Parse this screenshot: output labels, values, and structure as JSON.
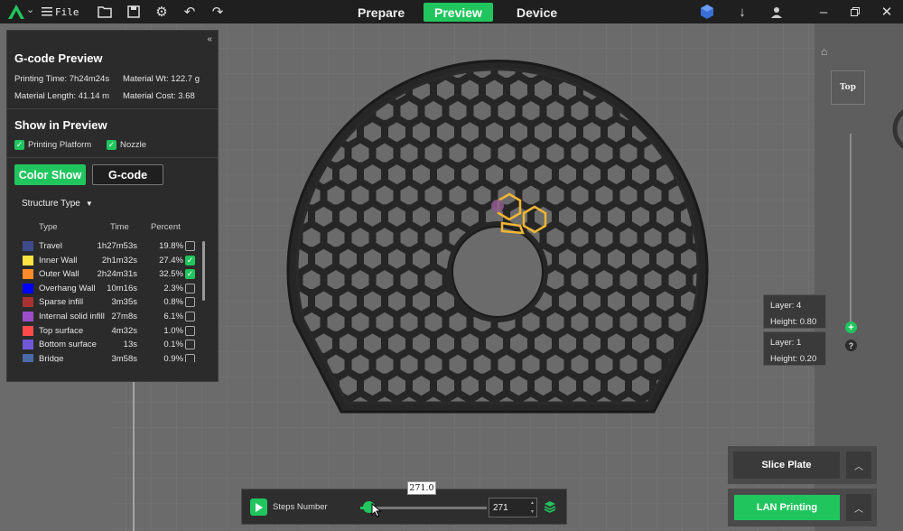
{
  "topbar": {
    "file_label": "File",
    "tabs": [
      {
        "label": "Prepare",
        "active": false
      },
      {
        "label": "Preview",
        "active": true
      },
      {
        "label": "Device",
        "active": false
      }
    ]
  },
  "gcode_preview": {
    "title": "G-code Preview",
    "printing_time": "Printing Time: 7h24m24s",
    "material_wt": "Material Wt: 122.7 g",
    "material_length": "Material Length: 41.14 m",
    "material_cost": "Material Cost: 3.68"
  },
  "show_in_preview": {
    "title": "Show in Preview",
    "printing_platform": "Printing Platform",
    "nozzle": "Nozzle"
  },
  "view_buttons": {
    "color_show": "Color Show",
    "gcode": "G-code"
  },
  "structure": {
    "dropdown": "Structure Type",
    "headers": {
      "type": "Type",
      "time": "Time",
      "percent": "Percent"
    },
    "rows": [
      {
        "name": "Travel",
        "time": "1h27m53s",
        "percent": "19.8%",
        "color": "#3f4a8c",
        "checked": false
      },
      {
        "name": "Inner Wall",
        "time": "2h1m32s",
        "percent": "27.4%",
        "color": "#ffe340",
        "checked": true
      },
      {
        "name": "Outer Wall",
        "time": "2h24m31s",
        "percent": "32.5%",
        "color": "#ff8a2a",
        "checked": true
      },
      {
        "name": "Overhang Wall",
        "time": "10m16s",
        "percent": "2.3%",
        "color": "#0000ff",
        "checked": false
      },
      {
        "name": "Sparse infill",
        "time": "3m35s",
        "percent": "0.8%",
        "color": "#a83232",
        "checked": false
      },
      {
        "name": "Internal solid infill",
        "time": "27m8s",
        "percent": "6.1%",
        "color": "#9a4fc9",
        "checked": false
      },
      {
        "name": "Top surface",
        "time": "4m32s",
        "percent": "1.0%",
        "color": "#ff4a4a",
        "checked": false
      },
      {
        "name": "Bottom surface",
        "time": "13s",
        "percent": "0.1%",
        "color": "#6e58d8",
        "checked": false
      },
      {
        "name": "Bridge",
        "time": "3m58s",
        "percent": "0.9%",
        "color": "#4a6aa8",
        "checked": false
      }
    ]
  },
  "viewport": {
    "view_cube": "Top"
  },
  "layer_slider": {
    "top_layer": "Layer: 4",
    "top_height": "Height: 0.80",
    "bottom_layer": "Layer: 1",
    "bottom_height": "Height: 0.20",
    "help": "?"
  },
  "actions": {
    "slice_plate": "Slice Plate",
    "lan_printing": "LAN Printing"
  },
  "steps": {
    "label": "Steps Number",
    "value": "271",
    "tooltip": "271.0",
    "progress_fraction": 0.05
  },
  "colors": {
    "accent": "#21c55e",
    "toolpath_highlight": "#f2b632"
  }
}
